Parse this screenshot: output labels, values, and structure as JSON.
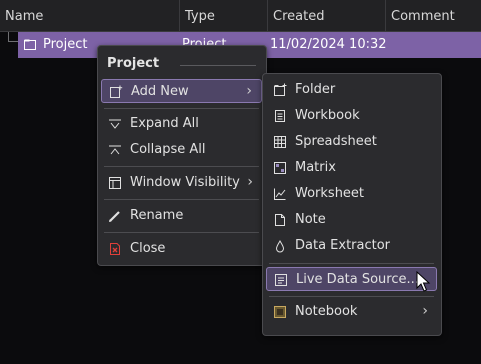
{
  "table": {
    "columns": [
      "Name",
      "Type",
      "Created",
      "Comment"
    ],
    "row": {
      "name": "Project",
      "type": "Project",
      "created": "11/02/2024 10:32"
    }
  },
  "context_menu": {
    "title": "Project",
    "items": {
      "add_new": "Add New",
      "expand_all": "Expand All",
      "collapse_all": "Collapse All",
      "window_visibility": "Window Visibility",
      "rename": "Rename",
      "close": "Close"
    }
  },
  "submenu": {
    "items": {
      "folder": "Folder",
      "workbook": "Workbook",
      "spreadsheet": "Spreadsheet",
      "matrix": "Matrix",
      "worksheet": "Worksheet",
      "note": "Note",
      "data_extractor": "Data Extractor",
      "live_data_source": "Live Data Source...",
      "notebook": "Notebook"
    }
  },
  "colors": {
    "selection": "#7d62a6",
    "menu_bg": "#2b2b2e",
    "hover": "#4e4566",
    "close_icon": "#e0403a"
  },
  "icons": {
    "row": "folder-icon",
    "add_new": "add-new-icon",
    "expand_all": "expand-all-icon",
    "collapse_all": "collapse-all-icon",
    "window_visibility": "window-icon",
    "rename": "pencil-icon",
    "close": "close-file-icon",
    "folder": "new-folder-icon",
    "workbook": "workbook-icon",
    "spreadsheet": "spreadsheet-icon",
    "matrix": "matrix-icon",
    "worksheet": "worksheet-icon",
    "note": "note-icon",
    "data_extractor": "drop-icon",
    "live_data_source": "live-data-icon",
    "notebook": "notebook-icon"
  }
}
